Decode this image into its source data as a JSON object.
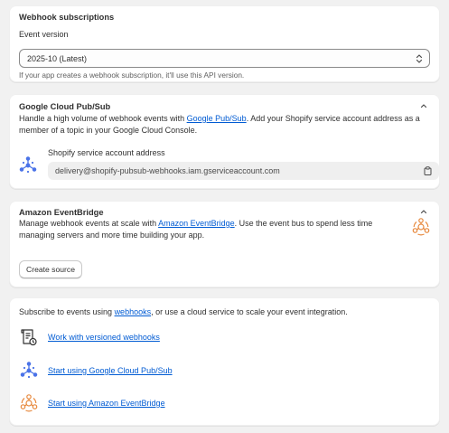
{
  "subscriptions": {
    "title": "Webhook subscriptions",
    "version_label": "Event version",
    "version_value": "2025-10 (Latest)",
    "help": "If your app creates a webhook subscription, it'll use this API version."
  },
  "pubsub": {
    "title": "Google Cloud Pub/Sub",
    "desc_before": "Handle a high volume of webhook events with ",
    "desc_link": "Google Pub/Sub",
    "desc_after": ". Add your Shopify service account address as a member of a topic in your Google Cloud Console.",
    "sa_label": "Shopify service account address",
    "sa_value": "delivery@shopify-pubsub-webhooks.iam.gserviceaccount.com"
  },
  "eventbridge": {
    "title": "Amazon EventBridge",
    "desc_before": "Manage webhook events at scale with ",
    "desc_link": "Amazon EventBridge",
    "desc_after": ". Use the event bus to spend less time managing servers and more time building your app.",
    "button": "Create source"
  },
  "integrations": {
    "desc_before": "Subscribe to events using ",
    "desc_link": "webhooks",
    "desc_after": ", or use a cloud service to scale your event integration.",
    "items": [
      {
        "label": "Work with versioned webhooks",
        "icon": "scroll-document-icon"
      },
      {
        "label": "Start using Google Cloud Pub/Sub",
        "icon": "google-pubsub-icon"
      },
      {
        "label": "Start using Amazon EventBridge",
        "icon": "amazon-eventbridge-icon"
      }
    ]
  },
  "colors": {
    "link": "#005bd3",
    "pubsub_blue": "#4a73e8",
    "eventbridge_orange": "#e7883c"
  }
}
